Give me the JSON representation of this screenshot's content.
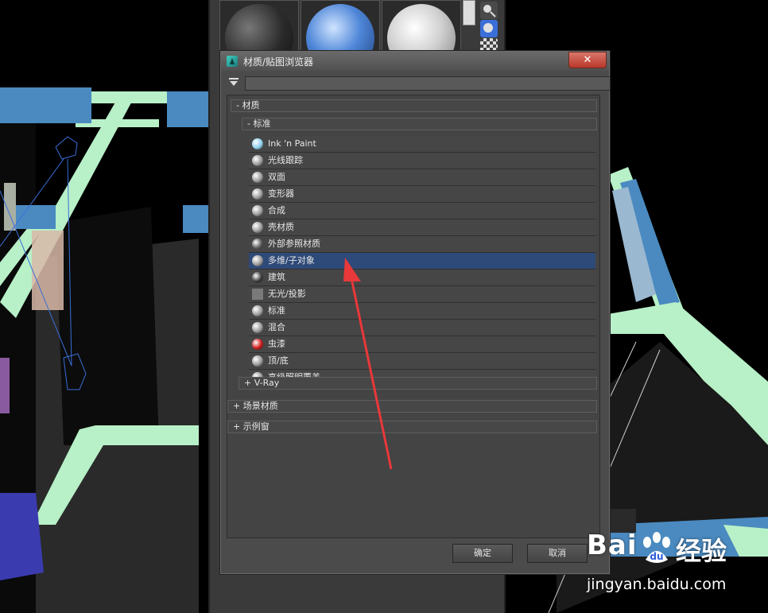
{
  "dialog": {
    "title": "材质/贴图浏览器",
    "close_label": "✕",
    "search": {
      "value": "",
      "placeholder": ""
    }
  },
  "groups": {
    "materials": "- 材质",
    "standard": "- 标准",
    "vray": "+ V-Ray",
    "scene_materials": "+ 场景材质",
    "sample_slots": "+ 示例窗"
  },
  "materials": [
    {
      "label": "Ink 'n Paint",
      "icon": "ink-n-paint-icon",
      "color": "#8fd0f0"
    },
    {
      "label": "光线跟踪",
      "icon": "raytrace-icon",
      "color": "#9a9a9a"
    },
    {
      "label": "双面",
      "icon": "double-sided-icon",
      "color": "#9a9a9a"
    },
    {
      "label": "变形器",
      "icon": "morpher-icon",
      "color": "#9a9a9a"
    },
    {
      "label": "合成",
      "icon": "composite-icon",
      "color": "#9a9a9a"
    },
    {
      "label": "壳材质",
      "icon": "shell-material-icon",
      "color": "#9a9a9a"
    },
    {
      "label": "外部参照材质",
      "icon": "xref-material-icon",
      "color": "#5a5a5a"
    },
    {
      "label": "多维/子对象",
      "icon": "multi-sub-object-icon",
      "color": "#9a9a9a",
      "selected": true
    },
    {
      "label": "建筑",
      "icon": "architectural-icon",
      "color": "#3a3a3a"
    },
    {
      "label": "无光/投影",
      "icon": "matte-shadow-icon",
      "color": "#7a7a7a"
    },
    {
      "label": "标准",
      "icon": "standard-icon",
      "color": "#9a9a9a"
    },
    {
      "label": "混合",
      "icon": "blend-icon",
      "color": "#9a9a9a"
    },
    {
      "label": "虫漆",
      "icon": "shellac-icon",
      "color": "#d01818"
    },
    {
      "label": "顶/底",
      "icon": "top-bottom-icon",
      "color": "#9a9a9a"
    },
    {
      "label": "高级照明覆盖",
      "icon": "advanced-lighting-override-icon",
      "color": "#9a9a9a"
    }
  ],
  "buttons": {
    "ok": "确定",
    "cancel": "取消"
  },
  "watermark": {
    "logo_text": "Bai",
    "cn_text": "经验",
    "url": "jingyan.baidu.com"
  },
  "colors": {
    "selection": "#2e4a78",
    "arrow": "#e8383a",
    "viewport_mint": "#b8f0c8",
    "viewport_blue": "#4a8ac0"
  }
}
